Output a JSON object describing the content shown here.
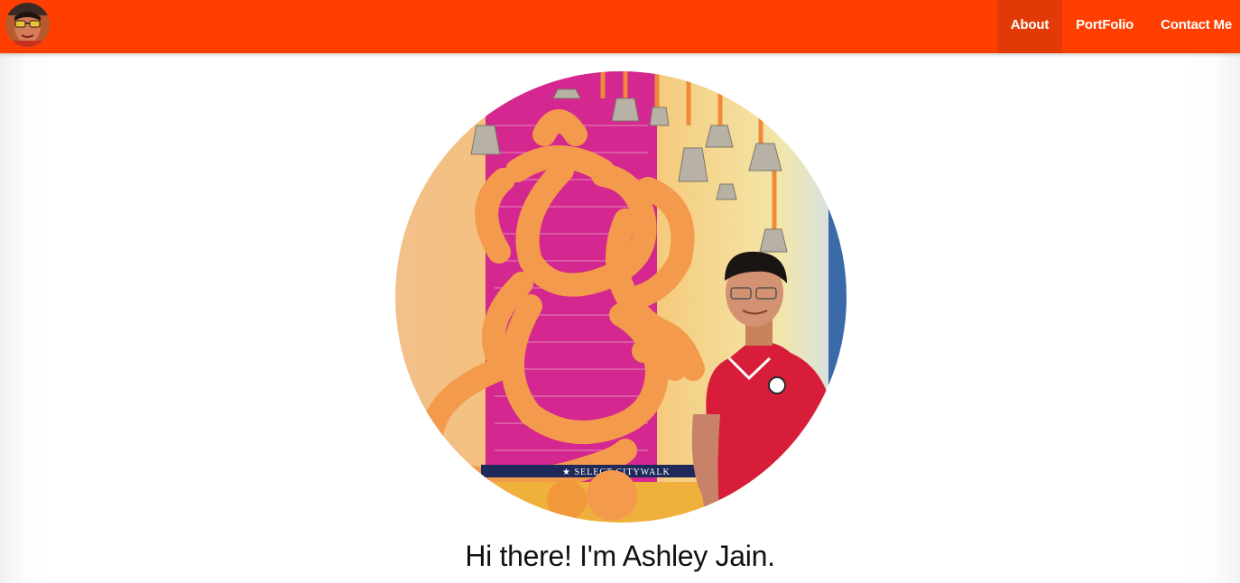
{
  "navbar": {
    "brand_color": "#ff3f00",
    "active_color": "#e23a06",
    "logo_icon": "avatar-icon",
    "links": [
      {
        "label": "About",
        "active": true
      },
      {
        "label": "PortFolio",
        "active": false
      },
      {
        "label": "Contact Me",
        "active": false
      }
    ]
  },
  "hero": {
    "photo_icon": "profile-photo",
    "photo_banner_text": "★ SELECT CITYWALK",
    "greeting": "Hi there! I'm Ashley Jain."
  }
}
